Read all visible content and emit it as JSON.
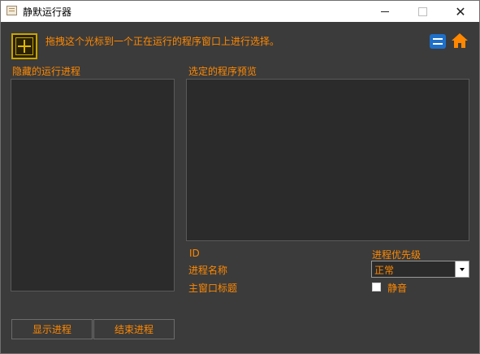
{
  "window": {
    "title": "静默运行器",
    "controls": {
      "minimize": "minimize-icon",
      "maximize": "maximize-icon",
      "close": "close-icon",
      "close_glyph": "✕"
    }
  },
  "toolbar": {
    "instruction": "拖拽这个光标到一个正在运行的程序窗口上进行选择。",
    "icons": [
      "crosshair-icon",
      "twitter-icon",
      "home-icon"
    ]
  },
  "labels": {
    "hidden_processes": "隐藏的运行进程",
    "selected_preview": "选定的程序预览",
    "id": "ID",
    "process_name": "进程名称",
    "main_window_title": "主窗口标题",
    "priority": "进程优先级",
    "mute": "静音"
  },
  "priority_select": {
    "value": "正常"
  },
  "mute_checkbox": {
    "checked": false
  },
  "buttons": {
    "show_process": "显示进程",
    "end_process": "结束进程"
  },
  "colors": {
    "background": "#3b3b3b",
    "panel": "#2b2b2b",
    "accent_text": "#ff8800",
    "crosshair": "#c9a400",
    "twitter": "#1e6fc8",
    "home": "#ff8800"
  }
}
